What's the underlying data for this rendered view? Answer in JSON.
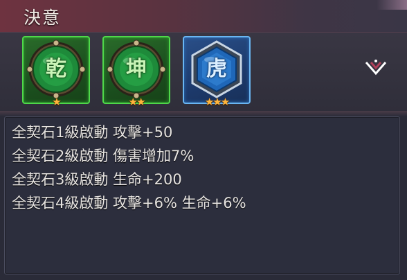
{
  "header": {
    "title": "決意"
  },
  "gems": [
    {
      "char": "乾",
      "stars": "★",
      "icon": "qian-gem-icon",
      "color": "#4fd84a"
    },
    {
      "char": "坤",
      "stars": "★★",
      "icon": "kun-gem-icon",
      "color": "#4fd84a"
    },
    {
      "char": "虎",
      "stars": "★★★",
      "icon": "tiger-gem-icon",
      "color": "#6ab6f2"
    }
  ],
  "collapse": {
    "icon": "chevron-up-icon"
  },
  "bonuses": [
    "全契石1級啟動 攻擊+50",
    "全契石2級啟動 傷害增加7%",
    "全契石3級啟動 生命+200",
    "全契石4級啟動 攻擊+6% 生命+6%"
  ]
}
